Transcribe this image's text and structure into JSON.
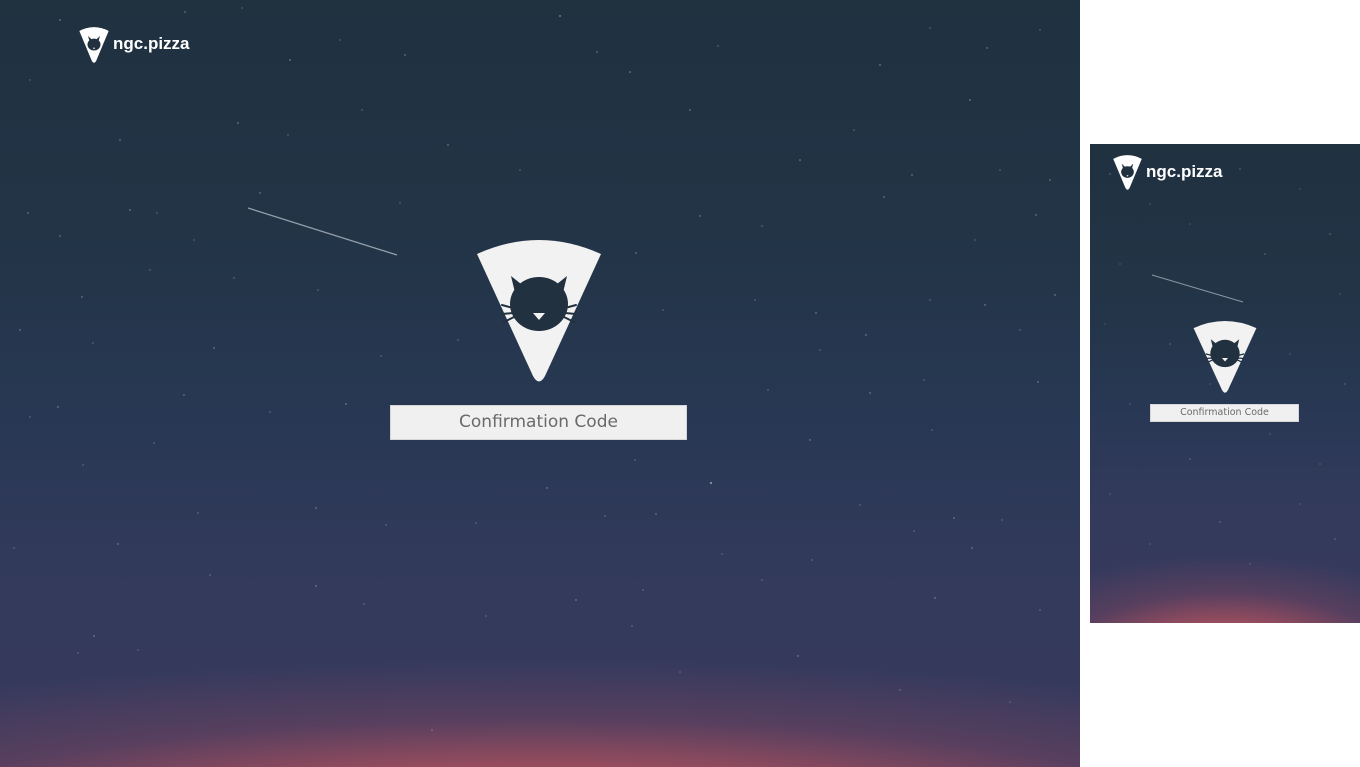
{
  "brand": {
    "name": "ngc.pizza",
    "logo_icon": "pizza-slice-cat-icon"
  },
  "hero": {
    "logo_icon": "pizza-slice-cat-icon"
  },
  "confirmation": {
    "placeholder": "Confirmation Code",
    "value": ""
  },
  "mobile_preview": {
    "brand_name": "ngc.pizza",
    "placeholder": "Confirmation Code"
  },
  "colors": {
    "sky_top": "#203140",
    "sky_mid": "#343a5c",
    "horizon_glow": "#c6565e",
    "logo_fill": "#f2f2f2",
    "cat_fill": "#22313f",
    "input_bg": "#f0f0f0",
    "input_text": "#6a6a6a"
  }
}
